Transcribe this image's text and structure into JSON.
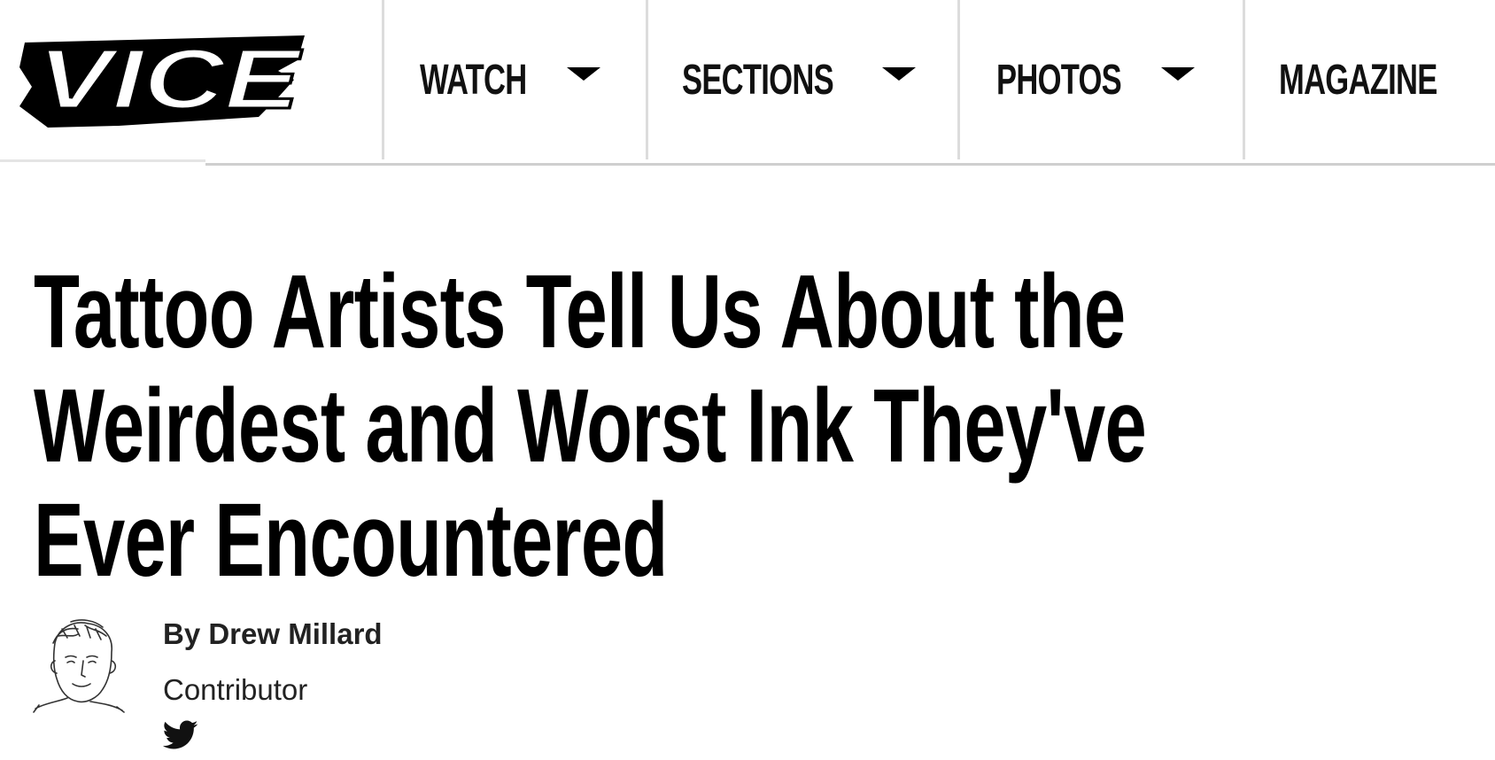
{
  "brand": {
    "logo_text": "VICE",
    "logo_icon": "vice-logo-icon"
  },
  "nav": {
    "items": [
      {
        "label": "WATCH",
        "has_dropdown": true
      },
      {
        "label": "SECTIONS",
        "has_dropdown": true
      },
      {
        "label": "PHOTOS",
        "has_dropdown": true
      },
      {
        "label": "MAGAZINE",
        "has_dropdown": false
      }
    ],
    "dropdown_icon": "caret-down-icon"
  },
  "article": {
    "title_lines": [
      "Tattoo Artists Tell Us About the",
      "Weirdest and Worst Ink They've",
      "Ever Encountered"
    ],
    "byline": {
      "author": "By Drew Millard",
      "role": "Contributor",
      "avatar_icon": "author-sketch-avatar",
      "social_icon": "twitter-icon"
    }
  },
  "colors": {
    "text": "#000000",
    "byline_text": "#222222",
    "divider": "#dcdcdc",
    "background": "#ffffff"
  }
}
